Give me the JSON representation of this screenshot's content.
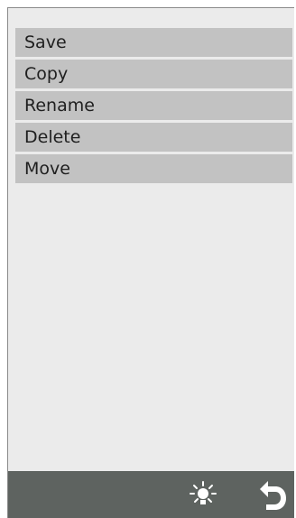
{
  "menu": {
    "items": [
      {
        "label": "Save"
      },
      {
        "label": "Copy"
      },
      {
        "label": "Rename"
      },
      {
        "label": "Delete"
      },
      {
        "label": "Move"
      }
    ]
  },
  "toolbar": {
    "icons": [
      "light-icon",
      "back-icon"
    ]
  },
  "colors": {
    "background": "#ebebeb",
    "menu_item": "#c2c2c2",
    "bottom_bar": "#5e6360",
    "icon": "#ffffff"
  }
}
